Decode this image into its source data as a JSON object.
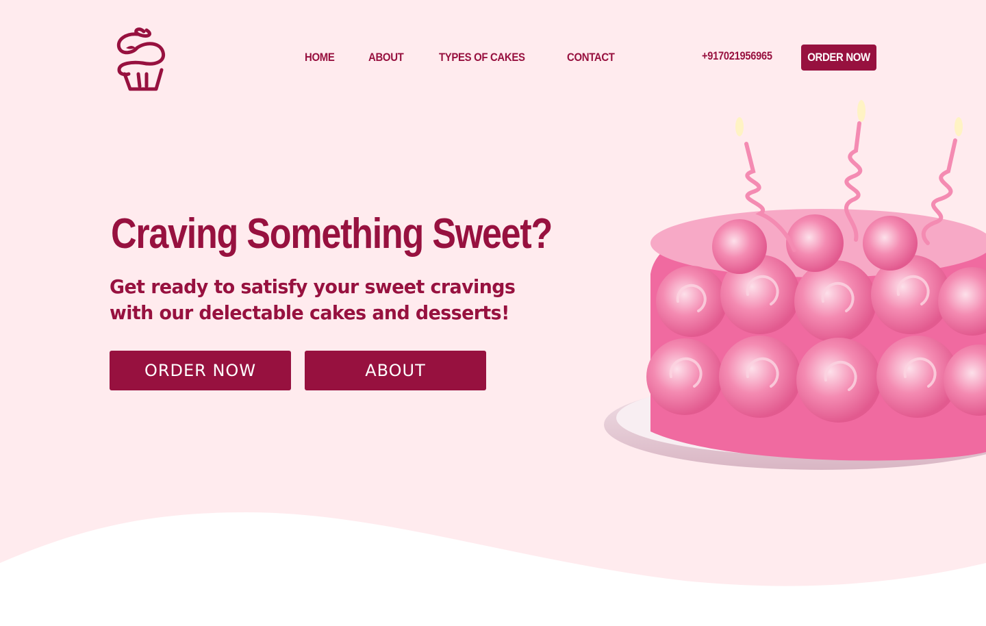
{
  "brand": {
    "logo_icon": "cupcake-icon",
    "color": "#97113f"
  },
  "nav": {
    "items": [
      {
        "label": "HOME"
      },
      {
        "label": "ABOUT"
      },
      {
        "label": "TYPES OF CAKES"
      },
      {
        "label": "CONTACT"
      }
    ],
    "phone": "+917021956965",
    "order_label": "ORDER NOW"
  },
  "hero": {
    "headline": "Craving Something Sweet?",
    "subtitle_line1": "Get ready to satisfy your sweet cravings",
    "subtitle_line2": "with our delectable cakes and desserts!",
    "order_label": "ORDER NOW",
    "about_label": "ABOUT",
    "image": "pink-rose-cake-with-candles"
  },
  "colors": {
    "background": "#ffebee",
    "accent": "#97113f",
    "white": "#ffffff"
  }
}
